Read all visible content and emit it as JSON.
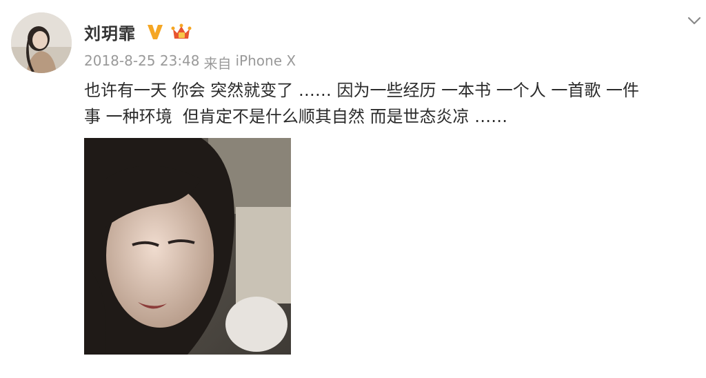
{
  "post": {
    "author": "刘玥霏",
    "icons": {
      "verified": "verified-v-icon",
      "member_badge": "member-crown-icon",
      "menu": "chevron-down-icon",
      "verified_color": "#f5a623",
      "member_color": "#e8542f"
    },
    "timestamp": "2018-8-25 23:48",
    "source_prefix": "来自",
    "source_device": "iPhone X",
    "content_lines": [
      "也许有一天 你会 突然就变了 …… 因为一些经历 一本书 一个人 一首歌 一件",
      "事 一种环境  但肯定不是什么顺其自然 而是世态炎凉 ……"
    ]
  }
}
